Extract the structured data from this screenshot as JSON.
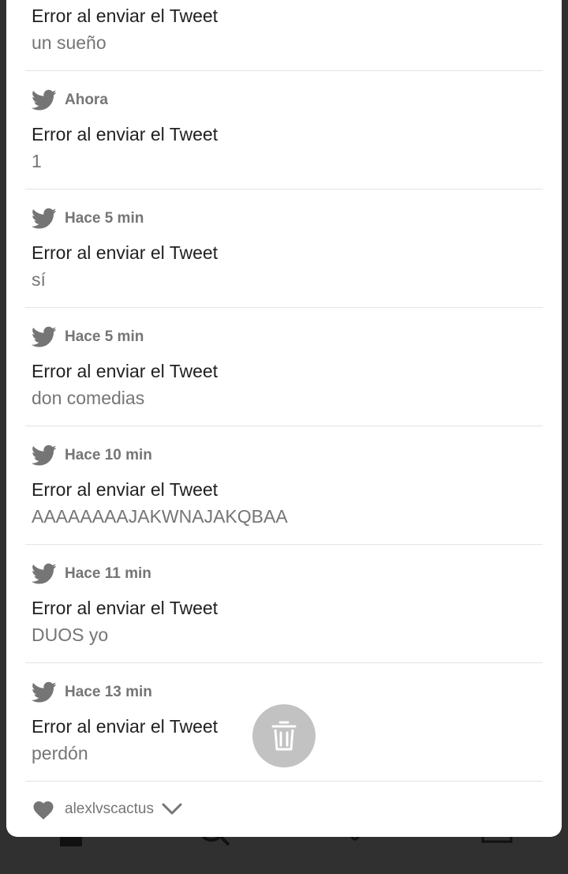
{
  "notifications": [
    {
      "time": "",
      "title": "Error al enviar el Tweet",
      "body": "un sueño"
    },
    {
      "time": "Ahora",
      "title": "Error al enviar el Tweet",
      "body": "1"
    },
    {
      "time": "Hace 5 min",
      "title": "Error al enviar el Tweet",
      "body": "sí"
    },
    {
      "time": "Hace 5 min",
      "title": "Error al enviar el Tweet",
      "body": "don comedias"
    },
    {
      "time": "Hace 10 min",
      "title": "Error al enviar el Tweet",
      "body": "AAAAAAAAJAKWNAJAKQBAA"
    },
    {
      "time": "Hace 11 min",
      "title": "Error al enviar el Tweet",
      "body": "DUOS yo"
    },
    {
      "time": "Hace 13 min",
      "title": "Error al enviar el Tweet",
      "body": "perdón"
    }
  ],
  "partial_notification": {
    "handle": "alexlvscactus"
  },
  "icons": {
    "app": "twitter-bird-icon",
    "partial": "heart-icon",
    "expand": "chevron-down-icon",
    "dismiss": "trash-icon"
  },
  "colors": {
    "sheet": "#ffffff",
    "scrim": "#303030",
    "title": "#212121",
    "secondary": "#757575",
    "trash_bubble": "#c2c2c2"
  }
}
